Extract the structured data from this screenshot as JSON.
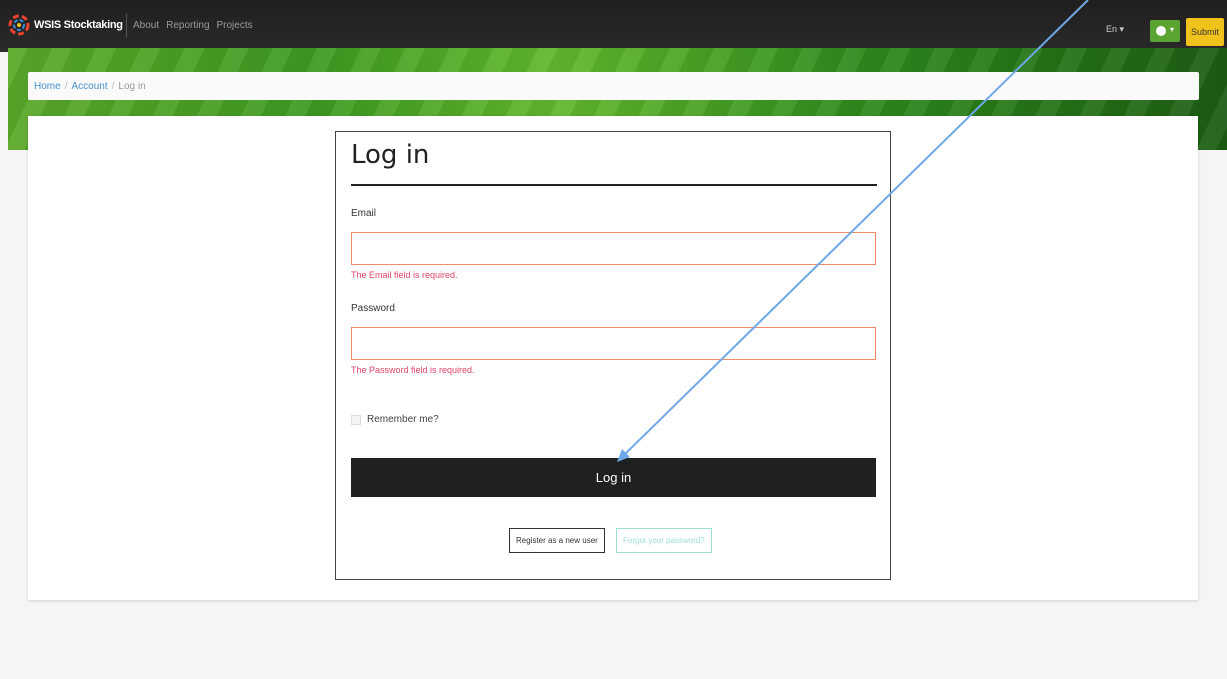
{
  "navbar": {
    "brand": "WSIS Stocktaking",
    "links": [
      "About",
      "Reporting",
      "Projects"
    ],
    "language": "En ▾",
    "user_caret": "▾",
    "submit_label": "Submit",
    "colors": {
      "background": "#222222",
      "user_button": "#5aa531",
      "submit_button": "#f2c21c"
    }
  },
  "breadcrumb": {
    "home": "Home",
    "account": "Account",
    "current": "Log in",
    "separator": "/"
  },
  "login": {
    "title": "Log in",
    "email_label": "Email",
    "email_value": "",
    "email_error": "The Email field is required.",
    "password_label": "Password",
    "password_value": "",
    "password_error": "The Password field is required.",
    "remember_label": "Remember me?",
    "submit_label": "Log in",
    "register_label": "Register as a new user",
    "forgot_label": "Forgot your password?"
  },
  "icons": {
    "logo": "wsis-logo-icon",
    "user": "user-icon",
    "checkbox": "checkbox-icon"
  },
  "annotation": {
    "type": "arrow",
    "color": "#6fa8e8"
  }
}
